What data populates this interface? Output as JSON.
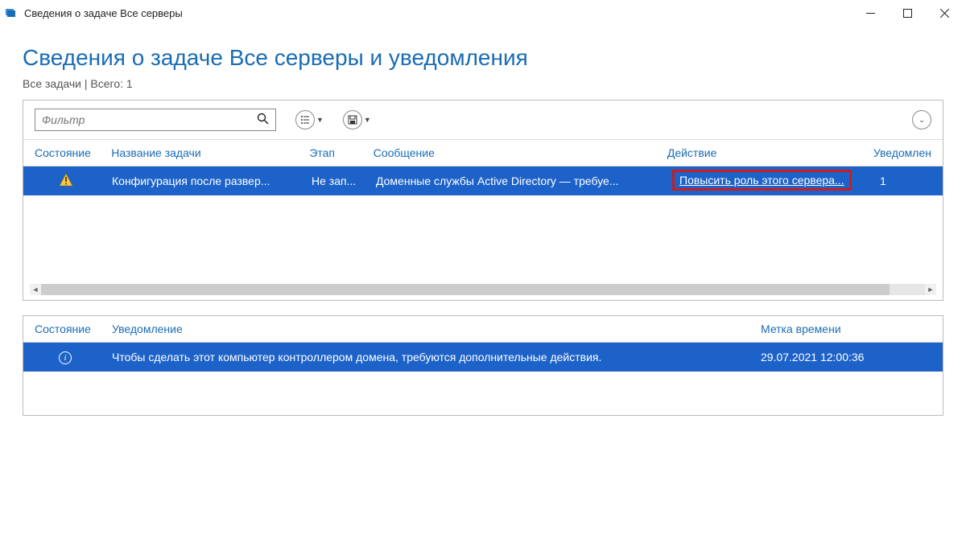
{
  "window": {
    "title": "Сведения о задаче Все серверы"
  },
  "page": {
    "heading": "Сведения о задаче Все серверы и уведомления",
    "subtitle": "Все задачи | Всего: 1"
  },
  "toolbar": {
    "filter_placeholder": "Фильтр"
  },
  "columns": {
    "state": "Состояние",
    "task": "Название задачи",
    "stage": "Этап",
    "message": "Сообщение",
    "action": "Действие",
    "notifications": "Уведомлен"
  },
  "rows": [
    {
      "task": "Конфигурация после развер...",
      "stage": "Не зап...",
      "message": "Доменные службы Active Directory — требуе...",
      "action": "Повысить роль этого сервера...",
      "notif_count": "1"
    }
  ],
  "columns2": {
    "state": "Состояние",
    "notification": "Уведомление",
    "timestamp": "Метка времени"
  },
  "rows2": [
    {
      "notification": "Чтобы сделать этот компьютер контроллером домена, требуются дополнительные действия.",
      "timestamp": "29.07.2021 12:00:36"
    }
  ]
}
